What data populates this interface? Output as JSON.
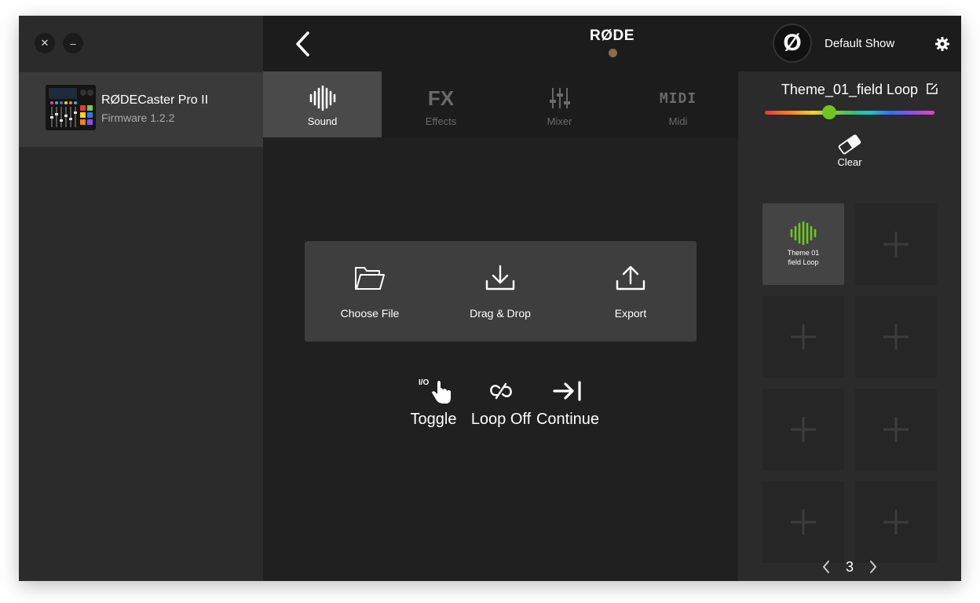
{
  "window": {
    "close_label": "✕",
    "minimize_label": "–"
  },
  "device": {
    "name": "RØDECaster Pro II",
    "firmware": "Firmware 1.2.2"
  },
  "header": {
    "logo": "RØDE",
    "show_icon": "Ø",
    "show_name": "Default Show",
    "logo_dot_color": "#8c6a4a"
  },
  "tabs": [
    {
      "label": "Sound",
      "icon": "waveform-icon",
      "active": true
    },
    {
      "label": "Effects",
      "icon": "fx-icon",
      "active": false
    },
    {
      "label": "Mixer",
      "icon": "mixer-icon",
      "active": false
    },
    {
      "label": "Midi",
      "icon": "midi-icon",
      "active": false
    }
  ],
  "tab_fx_glyph": "FX",
  "tab_midi_glyph": "MIDI",
  "actions": [
    {
      "label": "Choose File",
      "icon": "folder-icon"
    },
    {
      "label": "Drag & Drop",
      "icon": "download-icon"
    },
    {
      "label": "Export",
      "icon": "upload-icon"
    }
  ],
  "modes": [
    {
      "label": "Toggle",
      "icon": "toggle-hand-icon",
      "badge": "I/O"
    },
    {
      "label": "Loop Off",
      "icon": "loop-off-icon"
    },
    {
      "label": "Continue",
      "icon": "continue-icon"
    }
  ],
  "panel": {
    "sound_title": "Theme_01_field Loop",
    "color_slider_value": 0.38,
    "selected_color": "#6cc61f",
    "clear_label": "Clear",
    "pads": [
      {
        "label_line1": "Theme 01",
        "label_line2": "field Loop",
        "filled": true
      },
      {
        "filled": false
      },
      {
        "filled": false
      },
      {
        "filled": false
      },
      {
        "filled": false
      },
      {
        "filled": false
      },
      {
        "filled": false
      },
      {
        "filled": false
      }
    ],
    "page": "3"
  }
}
